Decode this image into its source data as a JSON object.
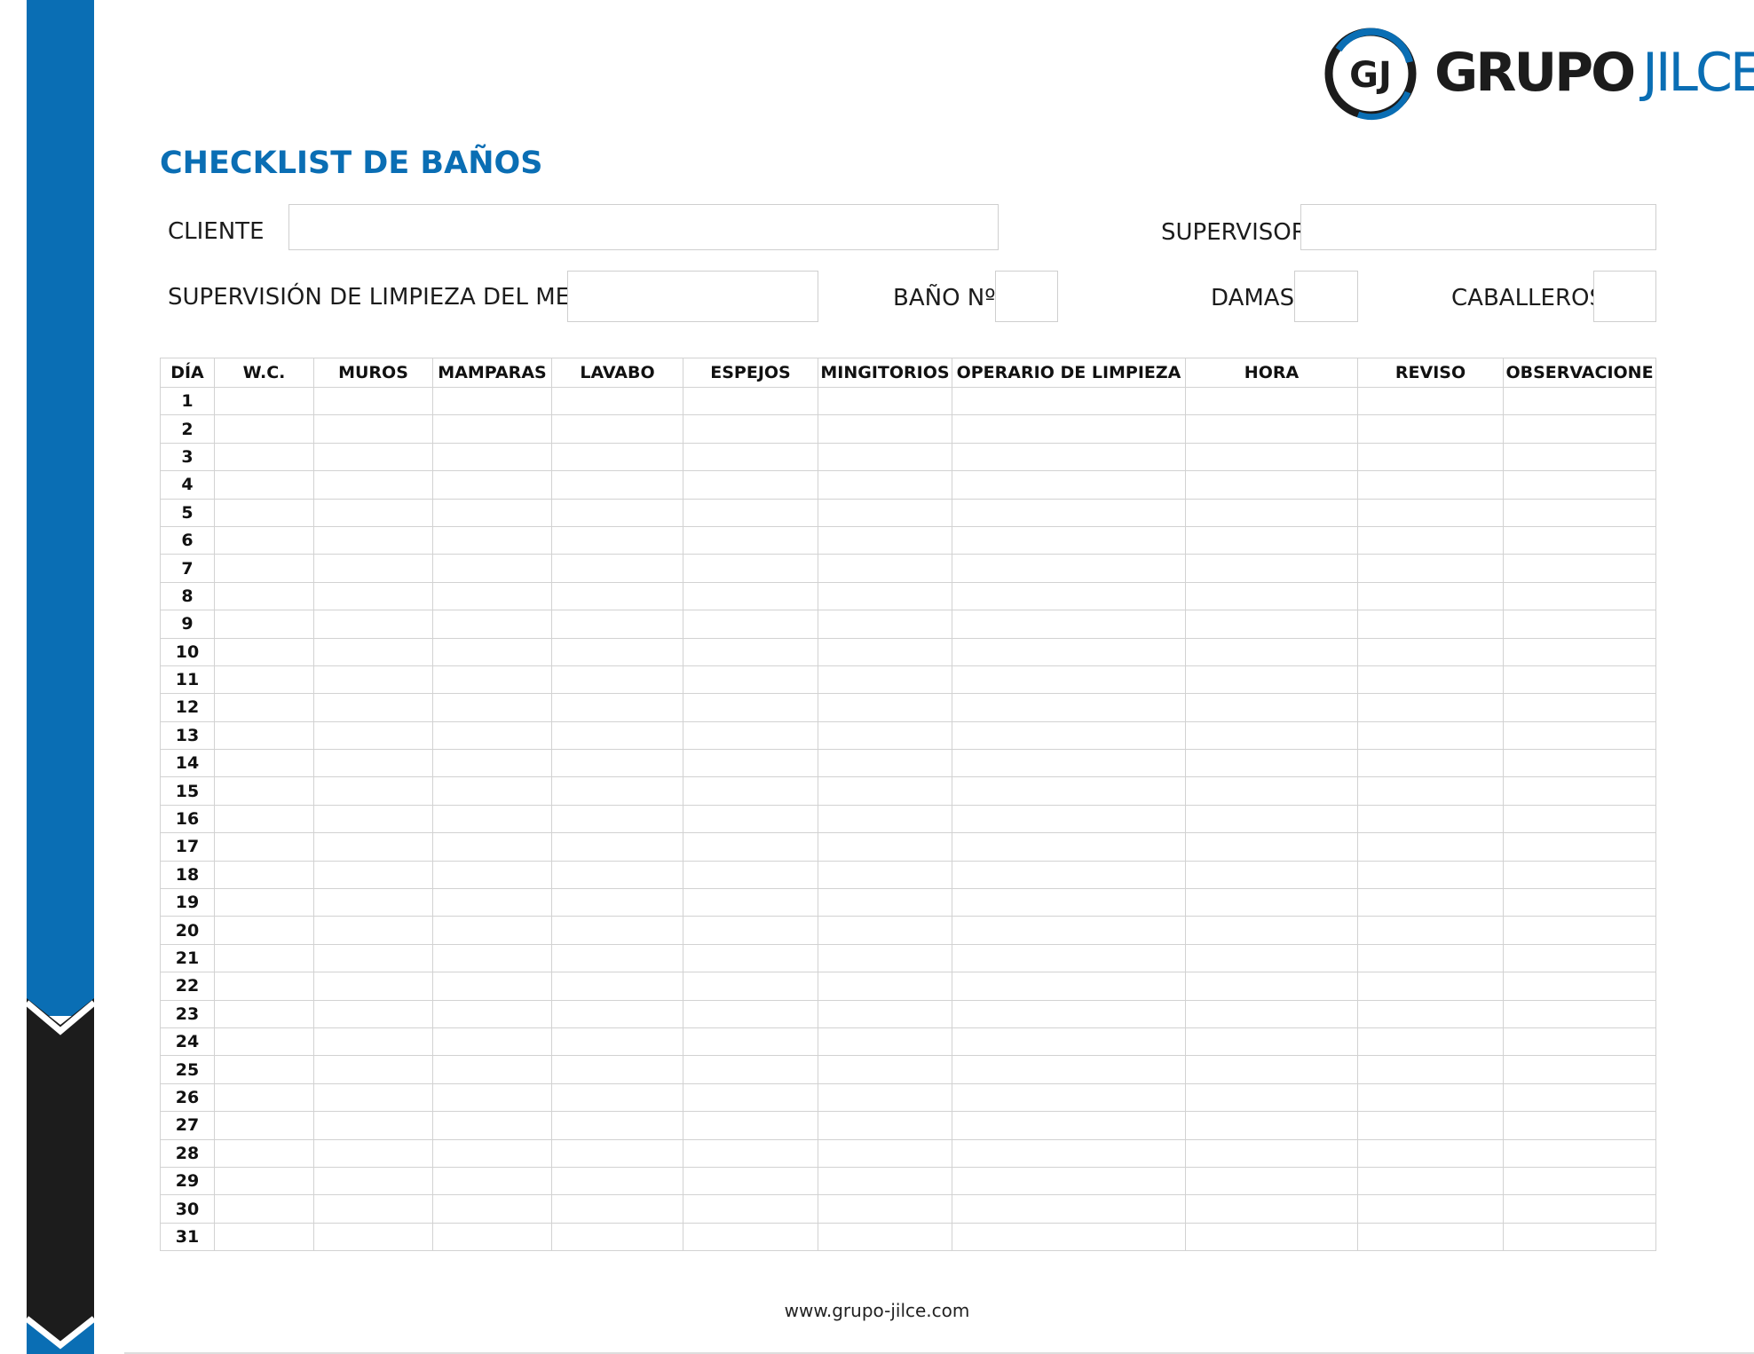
{
  "brand": {
    "logo_monogram": "GJ",
    "logo_word_1": "GRUPO",
    "logo_word_2": "JILCE",
    "blue": "#0a6eb4",
    "dark": "#1c1c1c"
  },
  "title": "CHECKLIST DE BAÑOS",
  "form": {
    "cliente_label": "CLIENTE",
    "cliente_value": "",
    "supervisor_label": "SUPERVISOR",
    "supervisor_value": "",
    "mes_label": "SUPERVISIÓN DE LIMPIEZA DEL MES",
    "mes_value": "",
    "bano_label": "BAÑO Nº",
    "bano_value": "",
    "damas_label": "DAMAS",
    "damas_value": "",
    "caballeros_label": "CABALLEROS",
    "caballeros_value": ""
  },
  "table": {
    "headers": [
      "DÍA",
      "W.C.",
      "MUROS",
      "MAMPARAS",
      "LAVABO",
      "ESPEJOS",
      "MINGITORIOS",
      "OPERARIO DE LIMPIEZA",
      "HORA",
      "REVISO",
      "OBSERVACIONE"
    ],
    "days": [
      "1",
      "2",
      "3",
      "4",
      "5",
      "6",
      "7",
      "8",
      "9",
      "10",
      "11",
      "12",
      "13",
      "14",
      "15",
      "16",
      "17",
      "18",
      "19",
      "20",
      "21",
      "22",
      "23",
      "24",
      "25",
      "26",
      "27",
      "28",
      "29",
      "30",
      "31"
    ]
  },
  "footer": "www.grupo-jilce.com"
}
